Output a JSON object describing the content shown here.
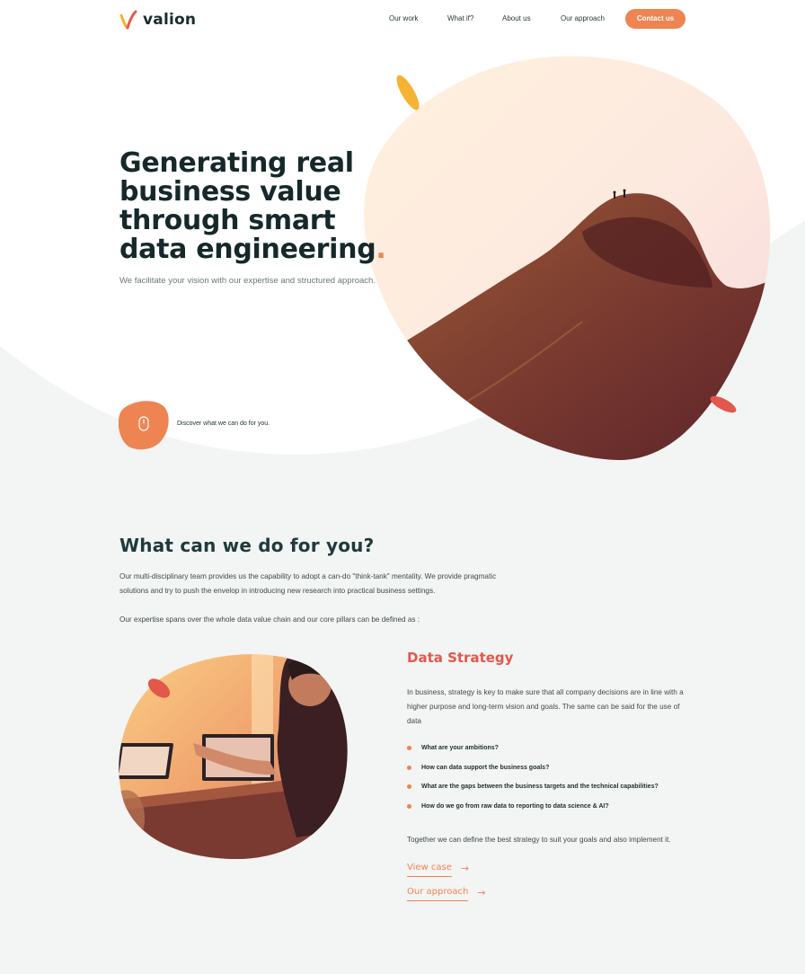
{
  "brand": {
    "name": "valion",
    "accent": "#ee8452",
    "accent_red": "#e2584b"
  },
  "nav": {
    "links": [
      "Our work",
      "What if?",
      "About us",
      "Our approach"
    ],
    "cta": "Contact us"
  },
  "hero": {
    "title_lines": [
      "Generating real",
      "business value",
      "through smart",
      "data engineering"
    ],
    "title_end": ".",
    "subtitle": "We facilitate your vision with our expertise and structured approach.",
    "scroll_icon": "mouse-icon",
    "discover": "Discover what we can do for you."
  },
  "section": {
    "title": "What can we do for you?",
    "intro_1": "Our multi-disciplinary team provides us the capability to adopt a can-do \"think-tank\" mentality. We provide pragmatic solutions and try to push the envelop in introducing new research into practical business settings.",
    "intro_2": "Our expertise spans over the whole data value chain and our core pillars can be defined as :"
  },
  "strategy": {
    "title": "Data Strategy",
    "description": "In business, strategy is key to make sure that all company decisions are in line with a higher purpose and long-term vision and goals. The same can be said for the use of data",
    "questions": [
      "What are your ambitions?",
      "How can data support the business goals?",
      "What are the gaps between the business targets and the technical capabilities?",
      "How do we go from raw data to reporting to data science & AI?"
    ],
    "closing": "Together we can define the best strategy to suit your goals and also implement it.",
    "links": [
      "View case",
      "Our approach"
    ],
    "arrow": "→"
  }
}
